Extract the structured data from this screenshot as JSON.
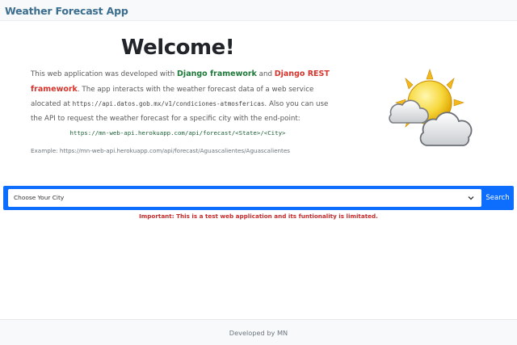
{
  "navbar": {
    "brand": "Weather Forecast App"
  },
  "main": {
    "title": "Welcome!",
    "intro_1": "This web application was developed with ",
    "django": "Django framework",
    "intro_2": " and ",
    "django_rest": "Django REST framework",
    "intro_3": ". The app interacts with the weather forecast data of a web service alocated at ",
    "service_url": "https://api.datos.gob.mx/v1/condiciones-atmosfericas",
    "intro_4": ". Also you can use the API to request the weather forecast for a specific city with the end-point:",
    "endpoint": "https://mn-web-api.herokuapp.com/api/forecast/<State>/<City>",
    "example": "Example: https://mn-web-api.herokuapp.com/api/forecast/Aguascalientes/Aguascalientes"
  },
  "search": {
    "selected": "Choose Your City",
    "button": "Search"
  },
  "notice": "Important: This is a test web application and its funtionality is limitated.",
  "footer": {
    "text": "Developed by MN"
  },
  "icons": {
    "weather": "sun-behind-clouds-icon",
    "chevron": "chevron-down-icon"
  },
  "colors": {
    "brand": "#3c6e8f",
    "search_bar": "#0d6efd",
    "django": "#1e7a3a",
    "django_rest": "#d6342c",
    "notice": "#c62b2b"
  }
}
